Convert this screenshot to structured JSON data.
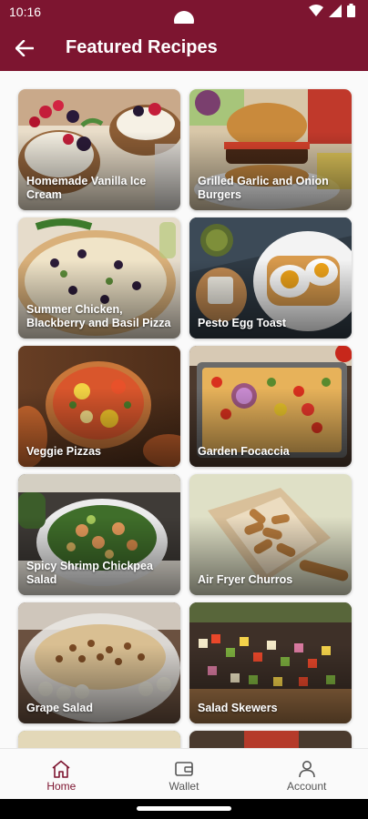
{
  "status_bar": {
    "time": "10:16"
  },
  "header": {
    "title": "Featured Recipes"
  },
  "recipes": [
    {
      "title": "Homemade Vanilla Ice Cream",
      "image": "ice-cream-berries"
    },
    {
      "title": "Grilled Garlic and Onion Burgers",
      "image": "burger"
    },
    {
      "title": "Summer Chicken, Blackberry and Basil Pizza",
      "image": "pizza-blackberry"
    },
    {
      "title": "Pesto Egg Toast",
      "image": "egg-toast"
    },
    {
      "title": "Veggie Pizzas",
      "image": "veggie-pizza"
    },
    {
      "title": "Garden Focaccia",
      "image": "focaccia"
    },
    {
      "title": "Spicy Shrimp Chickpea Salad",
      "image": "shrimp-salad"
    },
    {
      "title": "Air Fryer Churros",
      "image": "churros"
    },
    {
      "title": "Grape Salad",
      "image": "grape-salad"
    },
    {
      "title": "Salad Skewers",
      "image": "salad-skewers"
    }
  ],
  "bottom_nav": [
    {
      "label": "Home",
      "icon": "home-icon",
      "active": true
    },
    {
      "label": "Wallet",
      "icon": "wallet-icon",
      "active": false
    },
    {
      "label": "Account",
      "icon": "account-icon",
      "active": false
    }
  ],
  "colors": {
    "primary": "#7d1530",
    "background": "#fafafa"
  }
}
